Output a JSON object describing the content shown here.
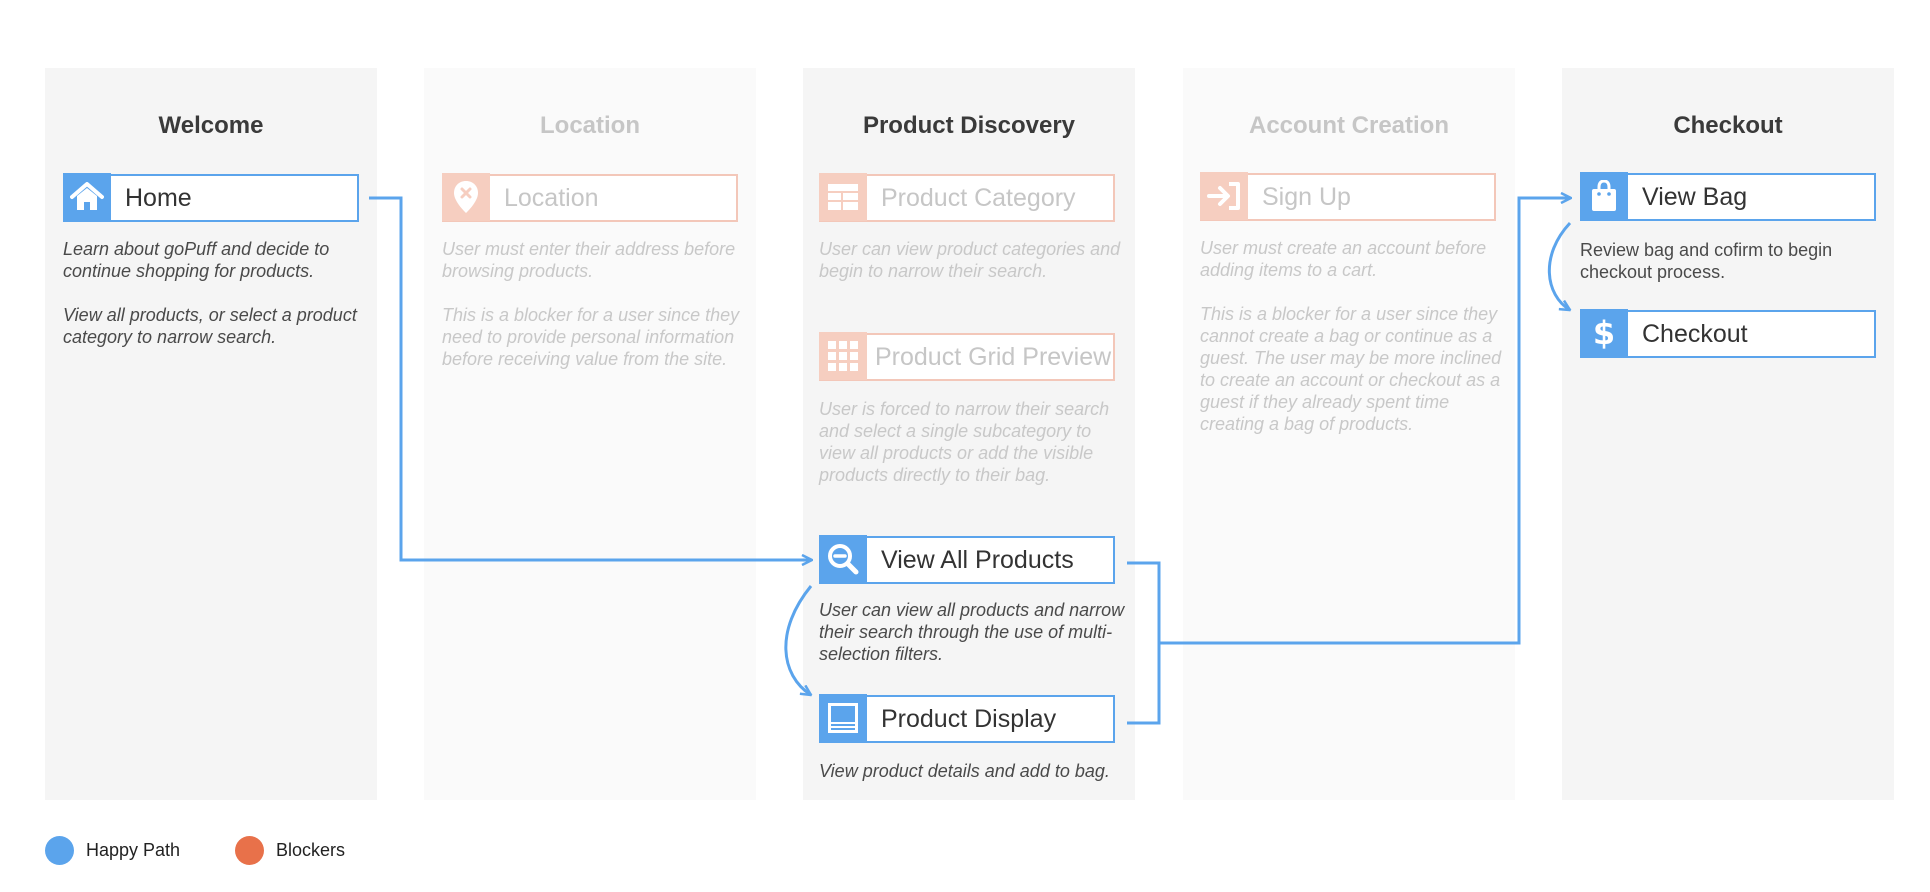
{
  "colors": {
    "happy_path": "#5ba4ec",
    "blocker": "#e8714a",
    "blocker_faded": "#f6cec0"
  },
  "columns": [
    {
      "title": "Welcome",
      "state": "active"
    },
    {
      "title": "Location",
      "state": "blocker"
    },
    {
      "title": "Product Discovery",
      "state": "active"
    },
    {
      "title": "Account Creation",
      "state": "blocker"
    },
    {
      "title": "Checkout",
      "state": "active"
    }
  ],
  "steps": {
    "home": {
      "label": "Home",
      "icon": "home-icon",
      "description": [
        "Learn about goPuff and decide to continue shopping for products.",
        "View all products, or select a product category to narrow search."
      ]
    },
    "location": {
      "label": "Location",
      "icon": "location-pin-icon",
      "description": [
        "User must enter their address before browsing products.",
        "This is a blocker for a user since they need to provide personal information before receiving value from the site."
      ]
    },
    "product_category": {
      "label": "Product Category",
      "icon": "category-list-icon",
      "description": [
        "User can view product categories and begin to narrow their search."
      ]
    },
    "product_grid_preview": {
      "label": "Product Grid Preview",
      "icon": "grid-icon",
      "description": [
        "User is forced to narrow their search and select a single subcategory to view all products or add the visible products directly to their bag."
      ]
    },
    "view_all_products": {
      "label": "View All Products",
      "icon": "zoom-out-icon",
      "description": [
        "User can view all products and narrow their search through the use of multi-selection filters."
      ]
    },
    "product_display": {
      "label": "Product Display",
      "icon": "product-display-icon",
      "description": [
        "View product details and add to bag."
      ]
    },
    "sign_up": {
      "label": "Sign Up",
      "icon": "sign-in-icon",
      "description": [
        "User must create an account before adding items to a cart.",
        "This is a blocker for a user since they cannot create a bag or continue as a guest. The user may be more inclined to create an account or checkout as a guest if they already spent time creating a bag of products."
      ]
    },
    "view_bag": {
      "label": "View Bag",
      "icon": "shopping-bag-icon",
      "description": [
        "Review bag and cofirm to begin checkout process."
      ]
    },
    "checkout": {
      "label": "Checkout",
      "icon": "dollar-icon",
      "description": []
    }
  },
  "legend": [
    {
      "label": "Happy Path",
      "kind": "happy_path"
    },
    {
      "label": "Blockers",
      "kind": "blocker"
    }
  ]
}
